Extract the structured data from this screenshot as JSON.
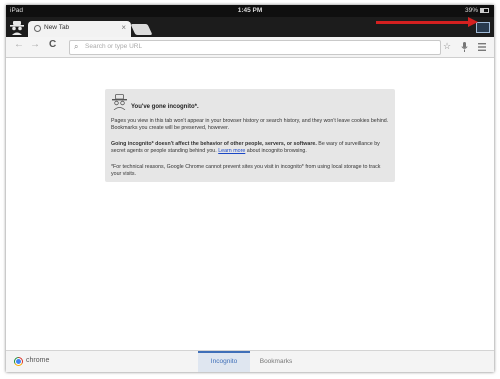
{
  "status_bar": {
    "device": "iPad",
    "time": "1:45 PM",
    "battery": "39%"
  },
  "tabs": [
    {
      "title": "New Tab"
    }
  ],
  "toolbar": {
    "omnibox_placeholder": "Search or type URL"
  },
  "incognito_card": {
    "heading": "You've gone incognito*.",
    "para1": "Pages you view in this tab won't appear in your browser history or search history, and they won't leave cookies behind. Bookmarks you create will be preserved, however.",
    "para2_bold": "Going incognito* doesn't affect the behavior of other people, servers, or software.",
    "para2_rest": " Be wary of surveillance by secret agents or people standing behind you. ",
    "para2_link": "Learn more",
    "para2_tail": " about incognito browsing.",
    "para3": "*For technical reasons, Google Chrome cannot prevent sites you visit in incognito* from using local storage to track your visits."
  },
  "bottom_bar": {
    "brand": "chrome",
    "tabs": [
      "Incognito",
      "Bookmarks"
    ],
    "active_tab": "Incognito"
  },
  "colors": {
    "annotation_arrow": "#d42020",
    "active_tab_accent": "#3f6fb8",
    "link": "#1a47c6"
  },
  "icons": [
    "back-arrow-icon",
    "forward-arrow-icon",
    "reload-icon",
    "search-icon",
    "star-icon",
    "microphone-icon",
    "menu-icon",
    "incognito-spy-icon",
    "tab-switcher-icon",
    "chrome-logo-icon",
    "globe-icon",
    "close-icon"
  ]
}
